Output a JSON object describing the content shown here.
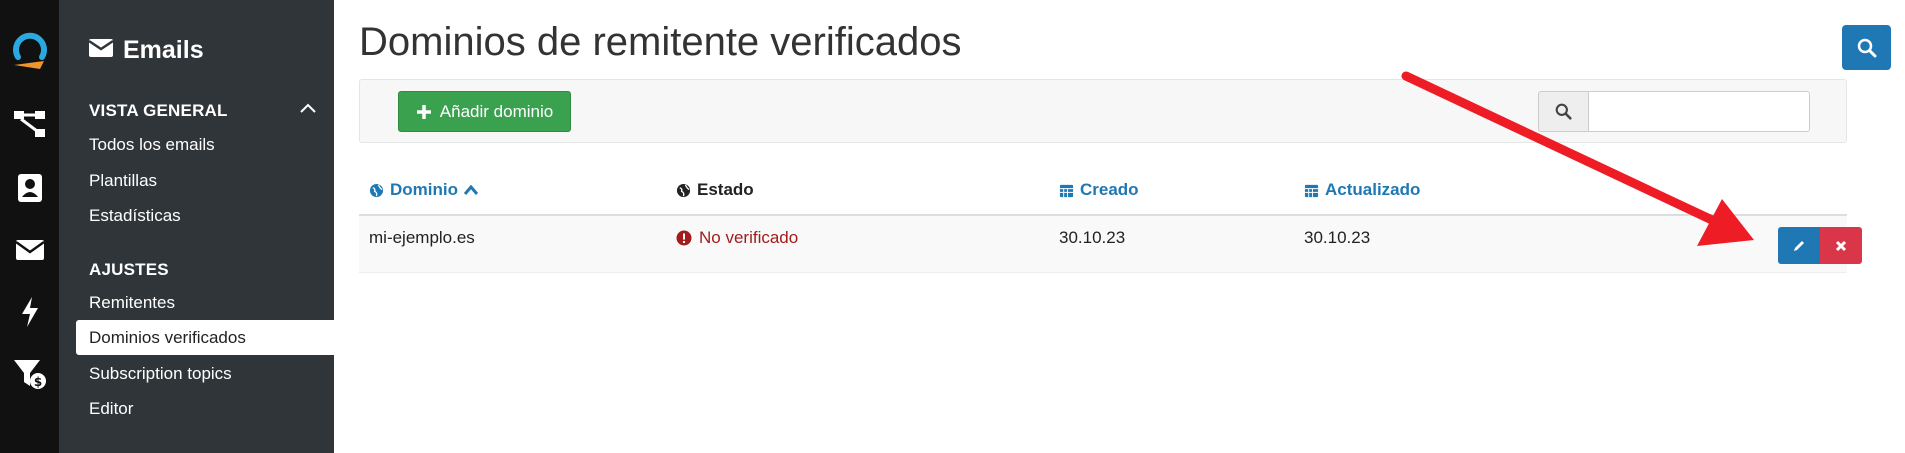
{
  "rail": {
    "icons": [
      "logo-icon",
      "workflow-icon",
      "contacts-icon",
      "emails-icon",
      "bolt-icon",
      "funnel-dollar-icon"
    ]
  },
  "sidebar": {
    "title": "Emails",
    "sections": [
      {
        "label": "VISTA GENERAL",
        "items": [
          "Todos los emails",
          "Plantillas",
          "Estadísticas"
        ]
      },
      {
        "label": "AJUSTES",
        "items": [
          "Remitentes",
          "Dominios verificados",
          "Subscription topics",
          "Editor"
        ]
      }
    ],
    "active_item": "Dominios verificados"
  },
  "main": {
    "title": "Dominios de remitente verificados",
    "add_button": "Añadir dominio",
    "search": {
      "value": "",
      "placeholder": ""
    },
    "table": {
      "headers": [
        "Dominio",
        "Estado",
        "Creado",
        "Actualizado"
      ],
      "rows": [
        {
          "domain": "mi-ejemplo.es",
          "status": "No verificado",
          "created": "30.10.23",
          "updated": "30.10.23"
        }
      ]
    }
  },
  "colors": {
    "primary": "#1f78b4",
    "success": "#3aa14f",
    "danger": "#d9364a",
    "error_text": "#a21c1c",
    "sidebar": "#2f3538",
    "rail": "#111111",
    "logo_accent": "#f0952c",
    "arrow": "#ee1c25"
  }
}
